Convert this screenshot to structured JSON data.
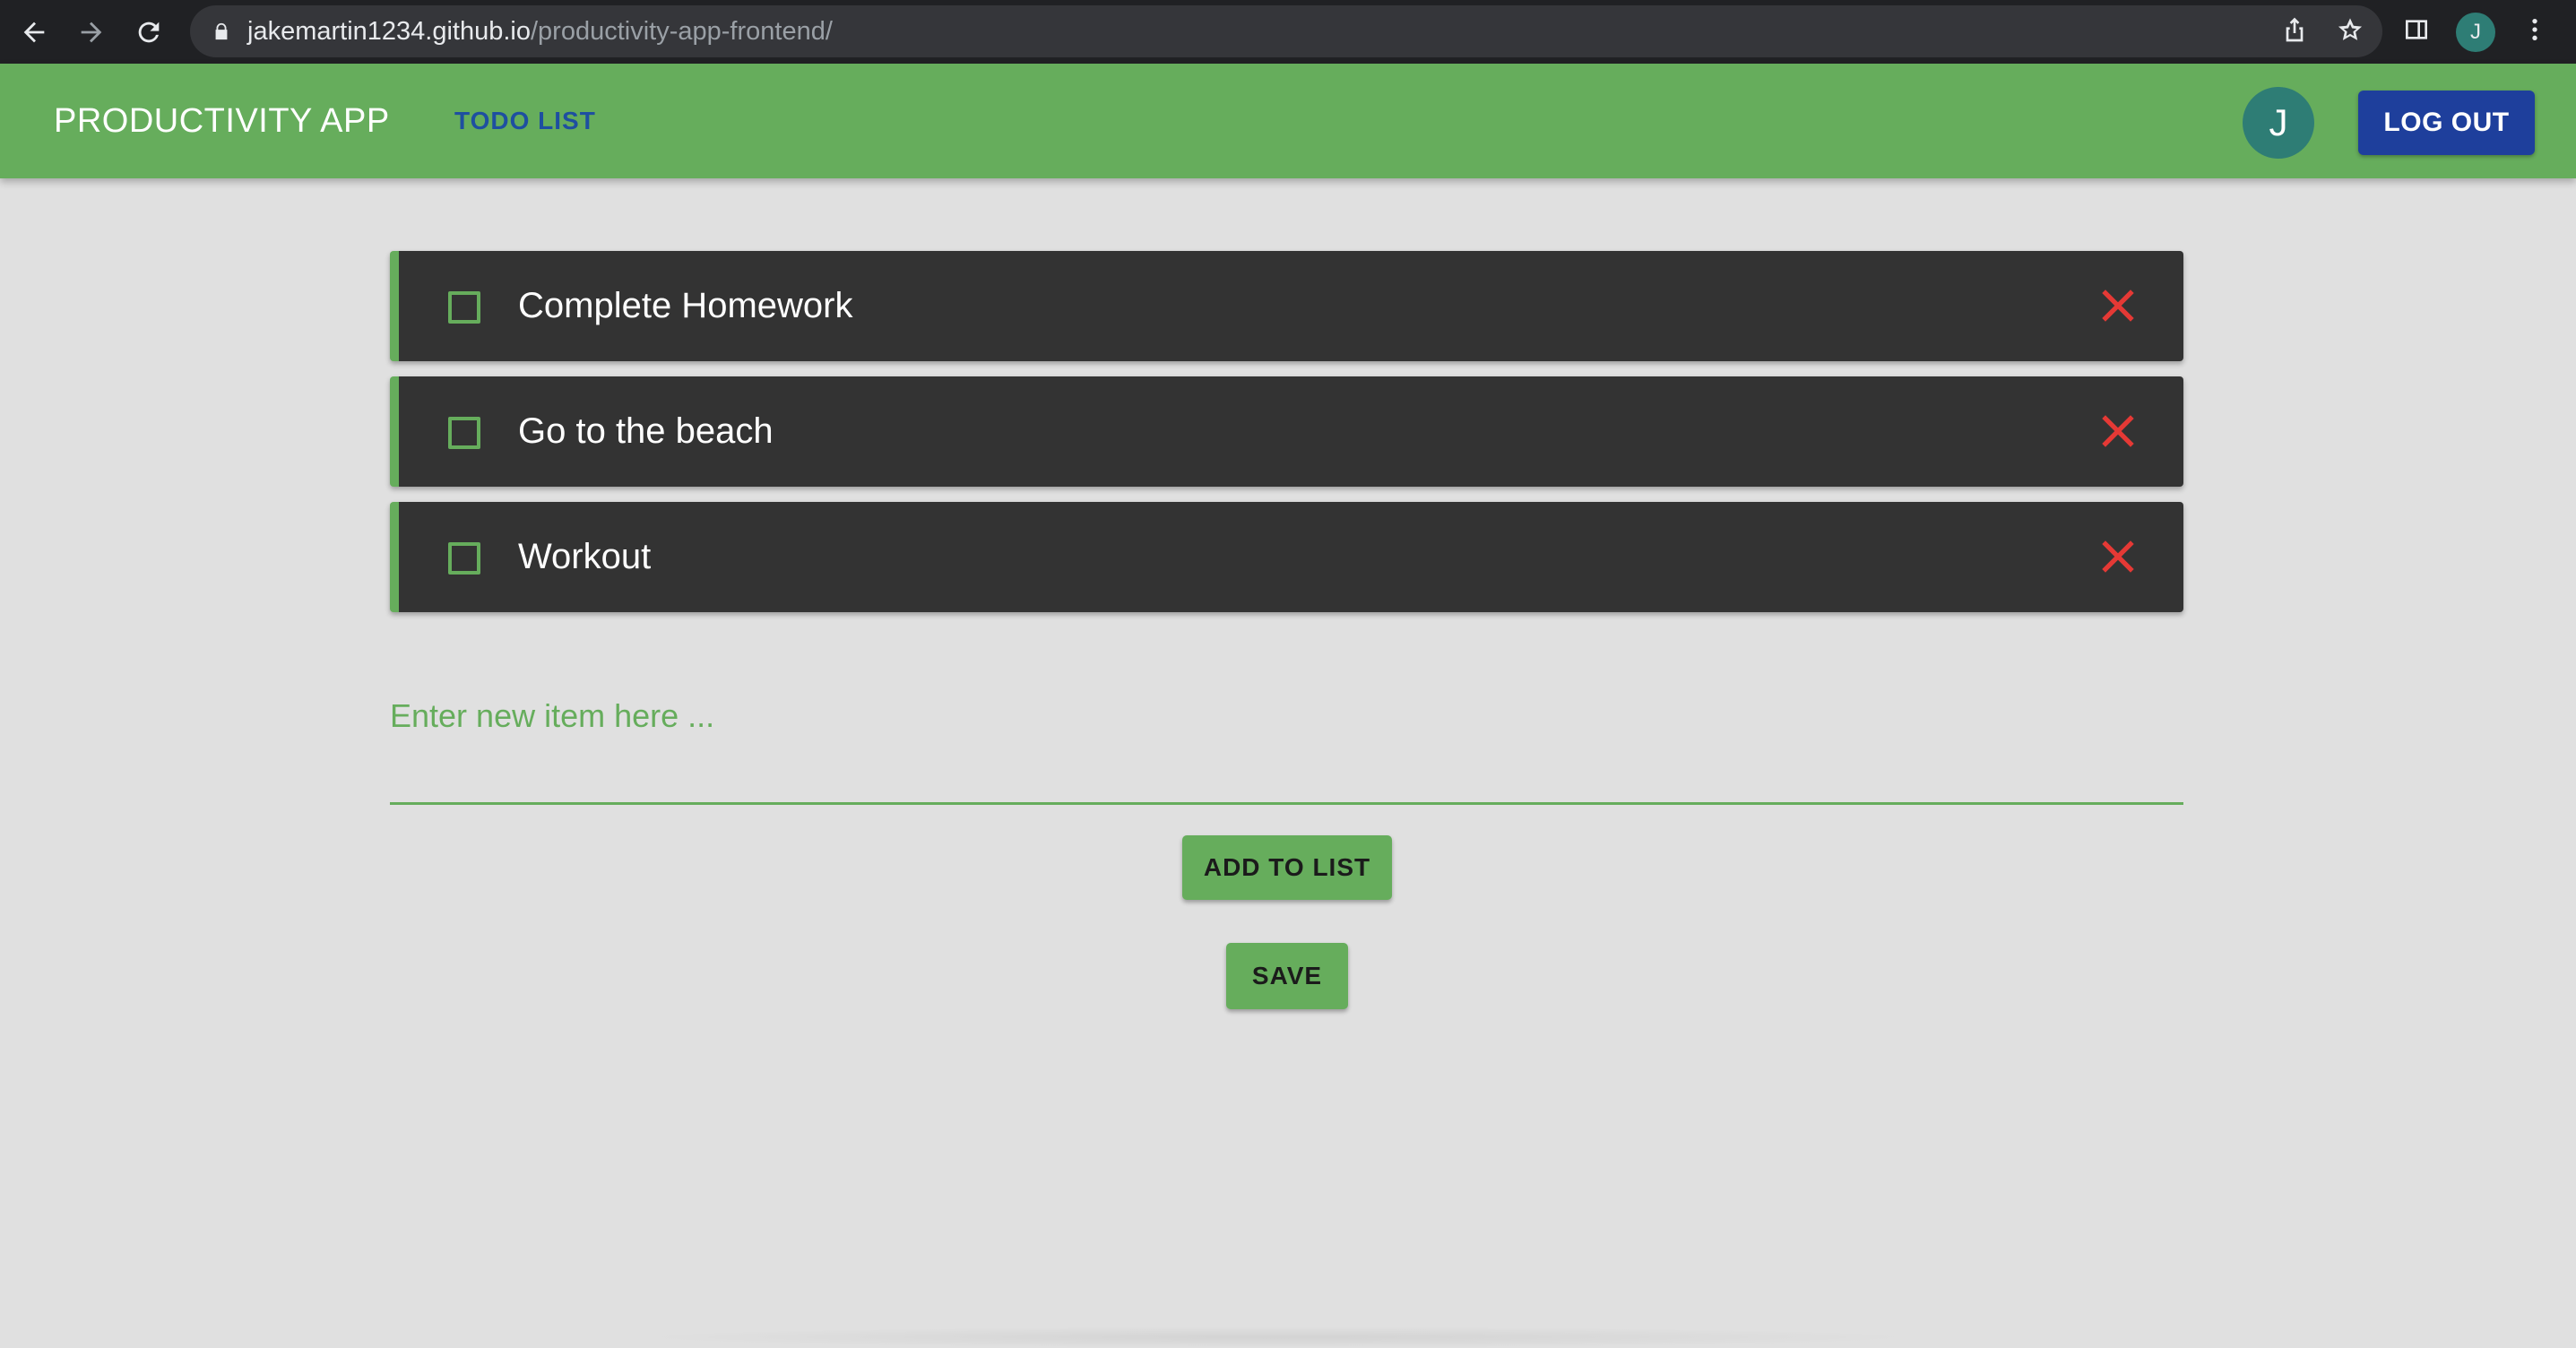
{
  "browser": {
    "url_host": "jakemartin1234.github.io",
    "url_path": "/productivity-app-frontend/",
    "profile_initial": "J"
  },
  "appbar": {
    "title": "PRODUCTIVITY APP",
    "nav_link": "TODO LIST",
    "avatar_initial": "J",
    "logout_label": "LOG OUT"
  },
  "todos": [
    {
      "text": "Complete Homework",
      "checked": false
    },
    {
      "text": "Go to the beach",
      "checked": false
    },
    {
      "text": "Workout",
      "checked": false
    }
  ],
  "new_item": {
    "placeholder": "Enter new item here ...",
    "value": ""
  },
  "buttons": {
    "add_label": "ADD TO LIST",
    "save_label": "SAVE"
  },
  "colors": {
    "primary_green": "#66ad5c",
    "logout_blue": "#1e3f9c",
    "delete_red": "#e53935",
    "item_bg": "#333333",
    "page_bg": "#e0e0e0"
  }
}
